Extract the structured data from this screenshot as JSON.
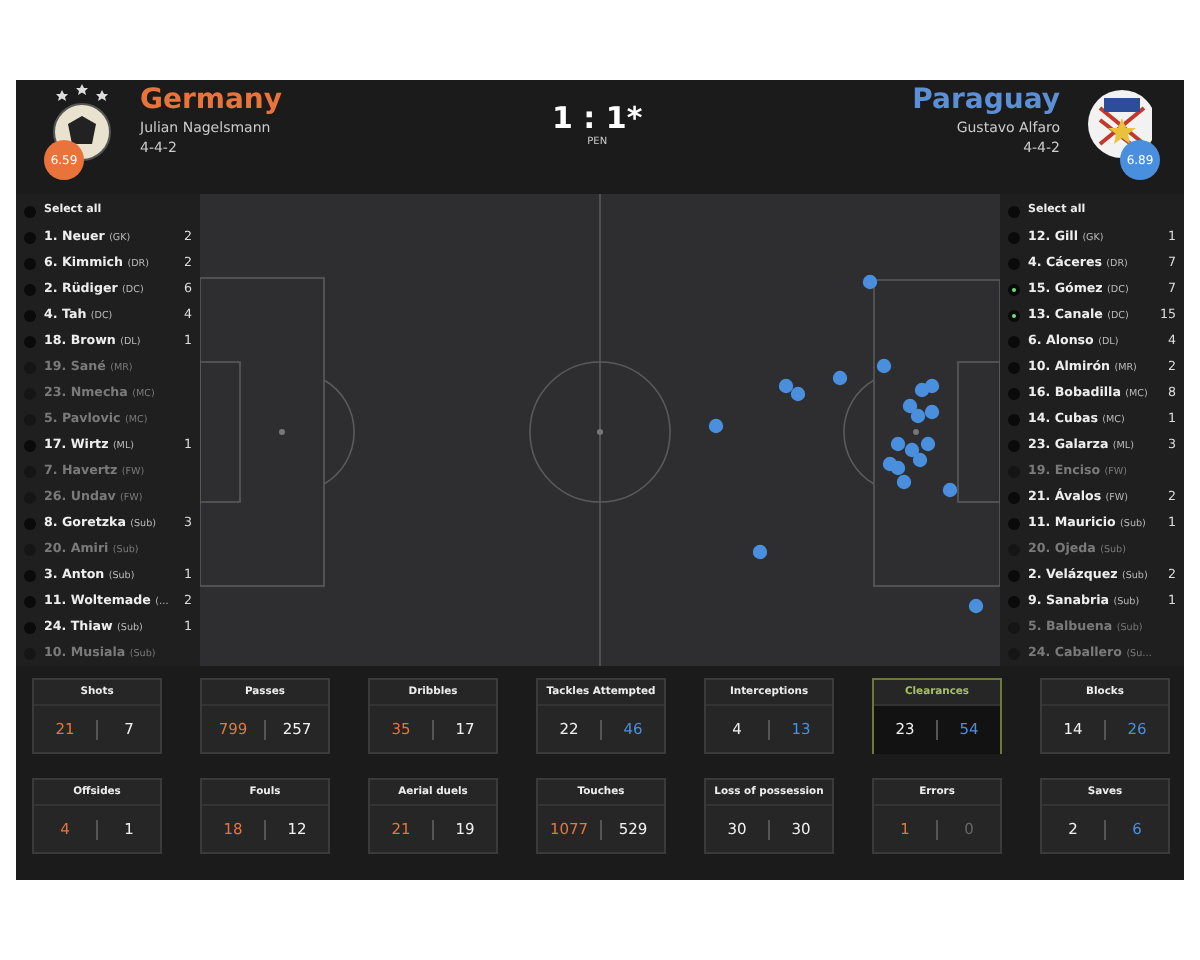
{
  "home": {
    "team": "Germany",
    "coach": "Julian Nagelsmann",
    "formation": "4-4-2",
    "rating": "6.59"
  },
  "score": {
    "result": "1 : 1*",
    "note": "PEN"
  },
  "away": {
    "team": "Paraguay",
    "coach": "Gustavo Alfaro",
    "formation": "4-4-2",
    "rating": "6.89"
  },
  "home_players": {
    "select_all": "Select all",
    "all_checked": false,
    "players": [
      {
        "label": "1. Neuer",
        "position": "(GK)",
        "count": "2",
        "active": true,
        "highlighted": false
      },
      {
        "label": "6. Kimmich",
        "position": "(DR)",
        "count": "2",
        "active": true,
        "highlighted": false
      },
      {
        "label": "2. Rüdiger",
        "position": "(DC)",
        "count": "6",
        "active": true,
        "highlighted": false
      },
      {
        "label": "4. Tah",
        "position": "(DC)",
        "count": "4",
        "active": true,
        "highlighted": false
      },
      {
        "label": "18. Brown",
        "position": "(DL)",
        "count": "1",
        "active": true,
        "highlighted": false
      },
      {
        "label": "19. Sané",
        "position": "(MR)",
        "active": false,
        "highlighted": false
      },
      {
        "label": "23. Nmecha",
        "position": "(MC)",
        "active": false,
        "highlighted": false
      },
      {
        "label": "5. Pavlovic",
        "position": "(MC)",
        "active": false,
        "highlighted": false
      },
      {
        "label": "17. Wirtz",
        "position": "(ML)",
        "count": "1",
        "active": true,
        "highlighted": false
      },
      {
        "label": "7. Havertz",
        "position": "(FW)",
        "active": false,
        "highlighted": false
      },
      {
        "label": "26. Undav",
        "position": "(FW)",
        "active": false,
        "highlighted": false
      },
      {
        "label": "8. Goretzka",
        "position": "(Sub)",
        "count": "3",
        "active": true,
        "highlighted": false
      },
      {
        "label": "20. Amiri",
        "position": "(Sub)",
        "active": false,
        "highlighted": false
      },
      {
        "label": "3. Anton",
        "position": "(Sub)",
        "count": "1",
        "active": true,
        "highlighted": false
      },
      {
        "label": "11. Woltemade",
        "position": "(…",
        "count": "2",
        "active": true,
        "highlighted": false
      },
      {
        "label": "24. Thiaw",
        "position": "(Sub)",
        "count": "1",
        "active": true,
        "highlighted": false
      },
      {
        "label": "10. Musiala",
        "position": "(Sub)",
        "active": false,
        "highlighted": false
      }
    ]
  },
  "away_players": {
    "select_all": "Select all",
    "all_checked": false,
    "players": [
      {
        "label": "12. Gill",
        "position": "(GK)",
        "count": "1",
        "active": true,
        "highlighted": false
      },
      {
        "label": "4. Cáceres",
        "position": "(DR)",
        "count": "7",
        "active": true,
        "highlighted": false
      },
      {
        "label": "15. Gómez",
        "position": "(DC)",
        "count": "7",
        "active": true,
        "highlighted": true
      },
      {
        "label": "13. Canale",
        "position": "(DC)",
        "count": "15",
        "active": true,
        "highlighted": true
      },
      {
        "label": "6. Alonso",
        "position": "(DL)",
        "count": "4",
        "active": true,
        "highlighted": false
      },
      {
        "label": "10. Almirón",
        "position": "(MR)",
        "count": "2",
        "active": true,
        "highlighted": false
      },
      {
        "label": "16. Bobadilla",
        "position": "(MC)",
        "count": "8",
        "active": true,
        "highlighted": false
      },
      {
        "label": "14. Cubas",
        "position": "(MC)",
        "count": "1",
        "active": true,
        "highlighted": false
      },
      {
        "label": "23. Galarza",
        "position": "(ML)",
        "count": "3",
        "active": true,
        "highlighted": false
      },
      {
        "label": "19. Enciso",
        "position": "(FW)",
        "active": false,
        "highlighted": false
      },
      {
        "label": "21. Ávalos",
        "position": "(FW)",
        "count": "2",
        "active": true,
        "highlighted": false
      },
      {
        "label": "11. Mauricio",
        "position": "(Sub)",
        "count": "1",
        "active": true,
        "highlighted": false
      },
      {
        "label": "20. Ojeda",
        "position": "(Sub)",
        "active": false,
        "highlighted": false
      },
      {
        "label": "2. Velázquez",
        "position": "(Sub)",
        "count": "2",
        "active": true,
        "highlighted": false
      },
      {
        "label": "9. Sanabria",
        "position": "(Sub)",
        "count": "1",
        "active": true,
        "highlighted": false
      },
      {
        "label": "5. Balbuena",
        "position": "(Sub)",
        "active": false,
        "highlighted": false
      },
      {
        "label": "24. Caballero",
        "position": "(Su…",
        "active": false,
        "highlighted": false
      }
    ]
  },
  "stats": [
    {
      "label": "Shots",
      "selected": false,
      "home": {
        "text": "21",
        "color": "#e8743b"
      },
      "away": {
        "text": "7",
        "color": "#f0f0f0"
      }
    },
    {
      "label": "Passes",
      "selected": false,
      "home": {
        "text": "799",
        "color": "#e8743b"
      },
      "away": {
        "text": "257",
        "color": "#f0f0f0"
      }
    },
    {
      "label": "Dribbles",
      "selected": false,
      "home": {
        "text": "35",
        "color": "#e8743b"
      },
      "away": {
        "text": "17",
        "color": "#f0f0f0"
      }
    },
    {
      "label": "Tackles Attempted",
      "selected": false,
      "home": {
        "text": "22",
        "color": "#f0f0f0"
      },
      "away": {
        "text": "46",
        "color": "#4a8fdd"
      }
    },
    {
      "label": "Interceptions",
      "selected": false,
      "home": {
        "text": "4",
        "color": "#f0f0f0"
      },
      "away": {
        "text": "13",
        "color": "#4a8fdd"
      }
    },
    {
      "label": "Clearances",
      "selected": true,
      "home": {
        "text": "23",
        "color": "#f0f0f0"
      },
      "away": {
        "text": "54",
        "color": "#4a8fdd"
      }
    },
    {
      "label": "Blocks",
      "selected": false,
      "home": {
        "text": "14",
        "color": "#f0f0f0"
      },
      "away": {
        "text": "26",
        "color": "#4a8fdd"
      }
    },
    {
      "label": "Offsides",
      "selected": false,
      "home": {
        "text": "4",
        "color": "#e8743b"
      },
      "away": {
        "text": "1",
        "color": "#f0f0f0"
      }
    },
    {
      "label": "Fouls",
      "selected": false,
      "home": {
        "text": "18",
        "color": "#e8743b"
      },
      "away": {
        "text": "12",
        "color": "#f0f0f0"
      }
    },
    {
      "label": "Aerial duels",
      "selected": false,
      "home": {
        "text": "21",
        "color": "#e8743b"
      },
      "away": {
        "text": "19",
        "color": "#f0f0f0"
      }
    },
    {
      "label": "Touches",
      "selected": false,
      "home": {
        "text": "1077",
        "color": "#e8743b"
      },
      "away": {
        "text": "529",
        "color": "#f0f0f0"
      }
    },
    {
      "label": "Loss of possession",
      "selected": false,
      "home": {
        "text": "30",
        "color": "#f0f0f0"
      },
      "away": {
        "text": "30",
        "color": "#f0f0f0"
      }
    },
    {
      "label": "Errors",
      "selected": false,
      "home": {
        "text": "1",
        "color": "#e8743b"
      },
      "away": {
        "text": "0",
        "color": "#666666"
      }
    },
    {
      "label": "Saves",
      "selected": false,
      "home": {
        "text": "2",
        "color": "#f0f0f0"
      },
      "away": {
        "text": "6",
        "color": "#4a8fdd"
      }
    }
  ]
}
